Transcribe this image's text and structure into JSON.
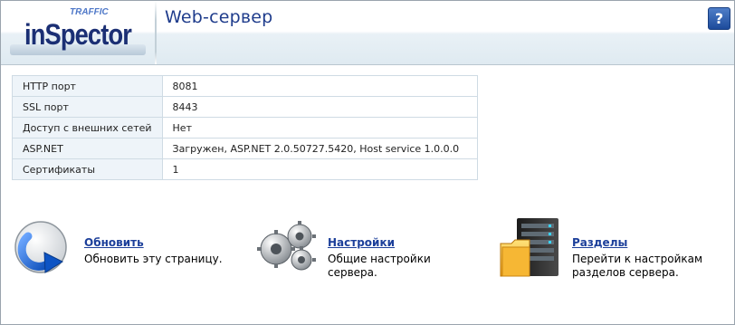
{
  "header": {
    "logo_text_top": "TRAFFIC",
    "logo_text_main": "inSpector",
    "title": "Web-сервер",
    "help_label": "?"
  },
  "info_table": [
    {
      "key": "HTTP порт",
      "value": "8081"
    },
    {
      "key": "SSL порт",
      "value": "8443"
    },
    {
      "key": "Доступ с внешних сетей",
      "value": "Нет"
    },
    {
      "key": "ASP.NET",
      "value": "Загружен, ASP.NET 2.0.50727.5420, Host service 1.0.0.0"
    },
    {
      "key": "Сертификаты",
      "value": "1"
    }
  ],
  "actions": [
    {
      "link": "Обновить",
      "desc": "Обновить эту страницу.",
      "icon": "refresh-arrow-icon"
    },
    {
      "link": "Настройки",
      "desc": "Общие настройки сервера.",
      "icon": "gears-icon"
    },
    {
      "link": "Разделы",
      "desc": "Перейти к настройкам разделов сервера.",
      "icon": "server-folder-icon"
    }
  ],
  "colors": {
    "title": "#1f3c8c",
    "link": "#1c3f9a",
    "table_key_bg": "#eef4f9",
    "table_border": "#cfdbe4"
  }
}
